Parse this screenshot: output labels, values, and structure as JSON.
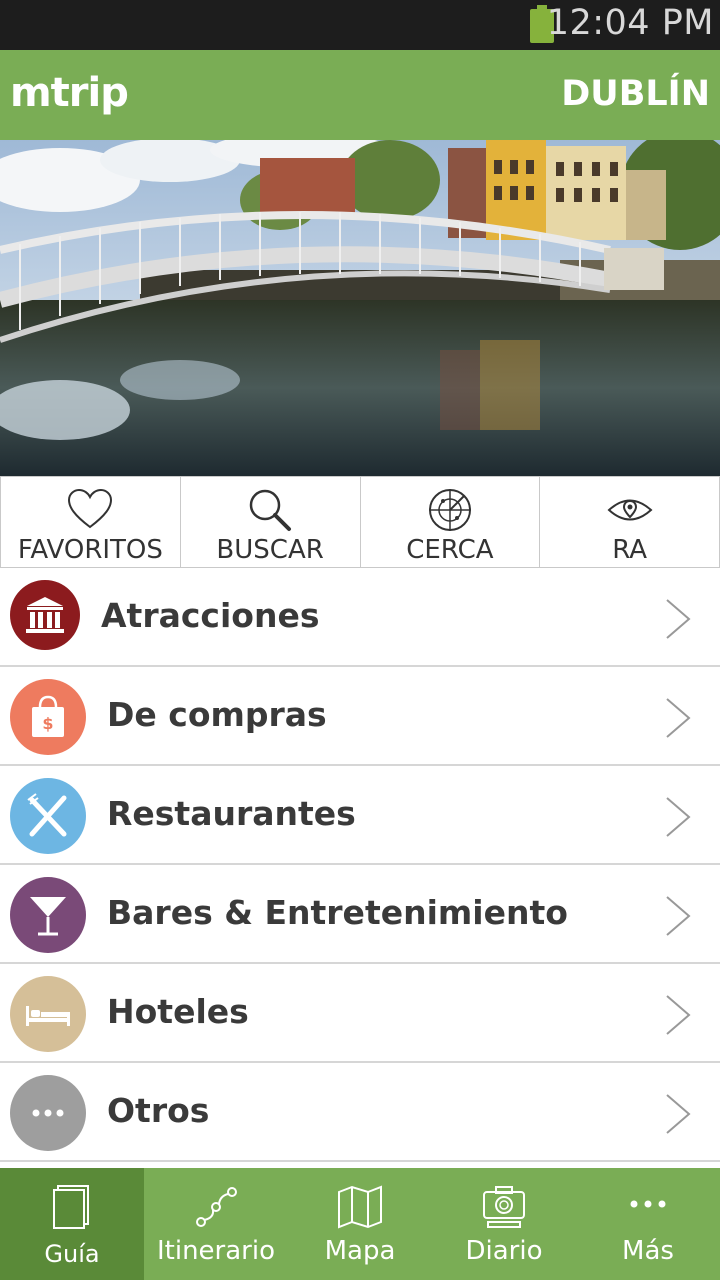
{
  "status_bar": {
    "time": "12:04 PM",
    "battery_icon": "battery-icon"
  },
  "header": {
    "logo": "mtrip",
    "city": "DUBLÍN"
  },
  "hero": {
    "image_icon": "hapenny-bridge-photo"
  },
  "quick_actions": [
    {
      "label": "FAVORITOS",
      "icon": "heart-icon"
    },
    {
      "label": "BUSCAR",
      "icon": "search-icon"
    },
    {
      "label": "CERCA",
      "icon": "radar-icon"
    },
    {
      "label": "RA",
      "icon": "eye-icon"
    }
  ],
  "categories": [
    {
      "label": "Atracciones",
      "icon": "museum-icon",
      "color": "#8c1b1e"
    },
    {
      "label": "De compras",
      "icon": "shopping-bag-icon",
      "color": "#ee7b5f"
    },
    {
      "label": "Restaurantes",
      "icon": "fork-knife-icon",
      "color": "#6db6e3"
    },
    {
      "label": "Bares & Entretenimiento",
      "icon": "cocktail-icon",
      "color": "#7a4a78"
    },
    {
      "label": "Hoteles",
      "icon": "bed-icon",
      "color": "#d5bf98"
    },
    {
      "label": "Otros",
      "icon": "more-dots-icon",
      "color": "#9e9e9e"
    }
  ],
  "bottom_nav": [
    {
      "label": "Guía",
      "icon": "guide-book-icon",
      "active": true
    },
    {
      "label": "Itinerario",
      "icon": "route-icon",
      "active": false
    },
    {
      "label": "Mapa",
      "icon": "map-icon",
      "active": false
    },
    {
      "label": "Diario",
      "icon": "camera-icon",
      "active": false
    },
    {
      "label": "Más",
      "icon": "more-icon",
      "active": false
    }
  ],
  "colors": {
    "brand_green": "#7aad55",
    "active_green": "#5a8a38"
  }
}
